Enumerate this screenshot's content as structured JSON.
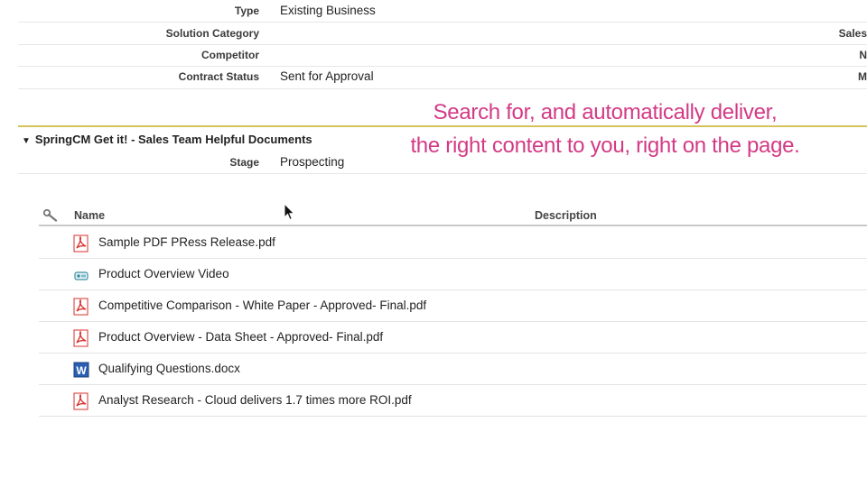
{
  "details": {
    "type": {
      "label": "Type",
      "value": "Existing Business"
    },
    "solution_category": {
      "label": "Solution Category",
      "value": "",
      "right": "Sales"
    },
    "competitor": {
      "label": "Competitor",
      "value": "",
      "right": "N"
    },
    "contract_status": {
      "label": "Contract Status",
      "value": "Sent for Approval",
      "right": "M"
    }
  },
  "section": {
    "title": "SpringCM Get it! - Sales Team Helpful Documents",
    "stage": {
      "label": "Stage",
      "value": "Prospecting"
    }
  },
  "callout": {
    "line1": "Search for, and automatically deliver,",
    "line2": "the right content to you, right on the page."
  },
  "table": {
    "columns": {
      "name": "Name",
      "description": "Description"
    },
    "rows": [
      {
        "name": "Sample PDF PRess Release.pdf",
        "icon": "pdf-icon"
      },
      {
        "name": "Product Overview Video",
        "icon": "video-icon"
      },
      {
        "name": "Competitive Comparison - White Paper - Approved- Final.pdf",
        "icon": "pdf-icon"
      },
      {
        "name": "Product Overview - Data Sheet - Approved- Final.pdf",
        "icon": "pdf-icon"
      },
      {
        "name": "Qualifying Questions.docx",
        "icon": "word-icon"
      },
      {
        "name": "Analyst Research - Cloud delivers 1.7 times more ROI.pdf",
        "icon": "pdf-icon"
      }
    ]
  },
  "colors": {
    "callout": "#d33a85",
    "divider": "#d4c35a",
    "pdf": "#d9302c",
    "word": "#2b5fb4"
  }
}
